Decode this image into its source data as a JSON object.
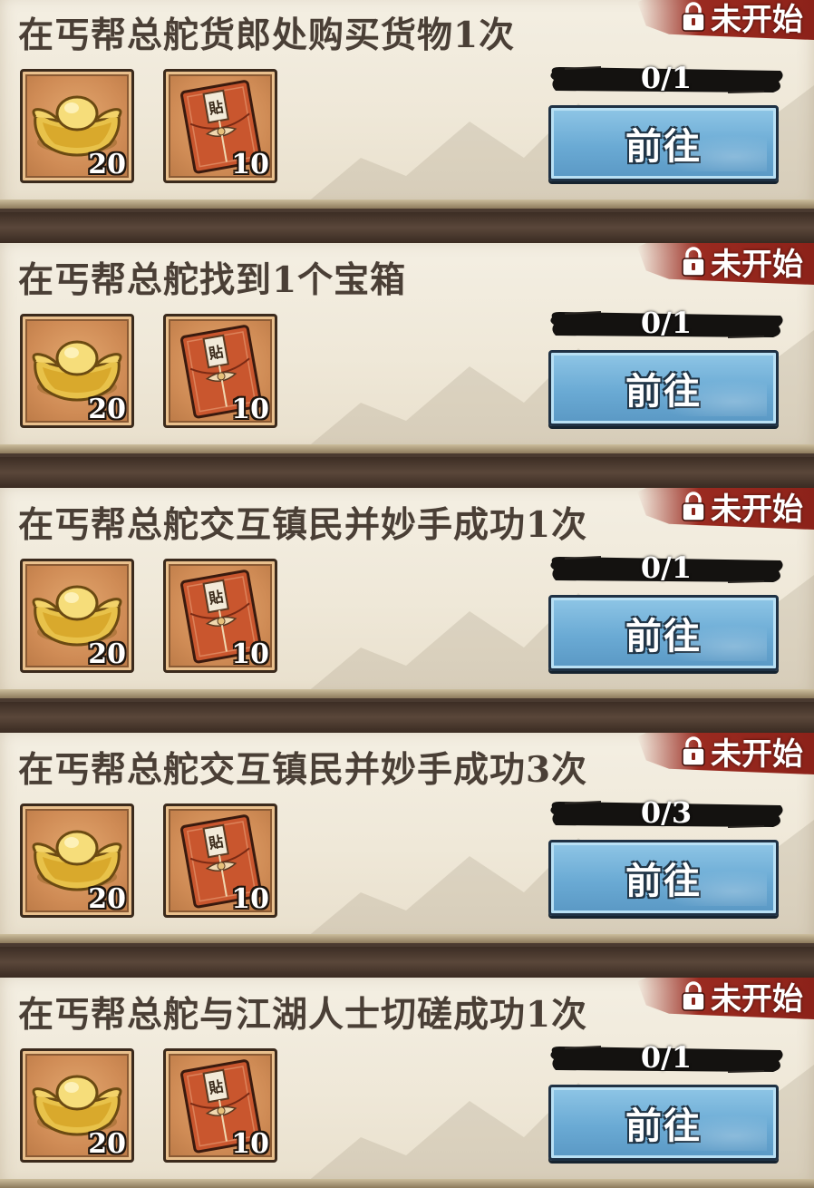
{
  "colors": {
    "panel_bg": "#efe8d8",
    "divider": "#4a3a30",
    "status_tag": "#9a2a20",
    "button_blue": "#6aaad4",
    "title_text": "#4a3f36"
  },
  "tasks": [
    {
      "title": "在丐帮总舵货郎处购买货物1次",
      "status": "未开始",
      "progress_text": "0/1",
      "button_label": "前往",
      "rewards": [
        {
          "icon": "gold-ingot-icon",
          "quantity": "20"
        },
        {
          "icon": "red-envelope-icon",
          "quantity": "10"
        }
      ]
    },
    {
      "title": "在丐帮总舵找到1个宝箱",
      "status": "未开始",
      "progress_text": "0/1",
      "button_label": "前往",
      "rewards": [
        {
          "icon": "gold-ingot-icon",
          "quantity": "20"
        },
        {
          "icon": "red-envelope-icon",
          "quantity": "10"
        }
      ]
    },
    {
      "title": "在丐帮总舵交互镇民并妙手成功1次",
      "status": "未开始",
      "progress_text": "0/1",
      "button_label": "前往",
      "rewards": [
        {
          "icon": "gold-ingot-icon",
          "quantity": "20"
        },
        {
          "icon": "red-envelope-icon",
          "quantity": "10"
        }
      ]
    },
    {
      "title": "在丐帮总舵交互镇民并妙手成功3次",
      "status": "未开始",
      "progress_text": "0/3",
      "button_label": "前往",
      "rewards": [
        {
          "icon": "gold-ingot-icon",
          "quantity": "20"
        },
        {
          "icon": "red-envelope-icon",
          "quantity": "10"
        }
      ]
    },
    {
      "title": "在丐帮总舵与江湖人士切磋成功1次",
      "status": "未开始",
      "progress_text": "0/1",
      "button_label": "前往",
      "rewards": [
        {
          "icon": "gold-ingot-icon",
          "quantity": "20"
        },
        {
          "icon": "red-envelope-icon",
          "quantity": "10"
        }
      ]
    }
  ]
}
